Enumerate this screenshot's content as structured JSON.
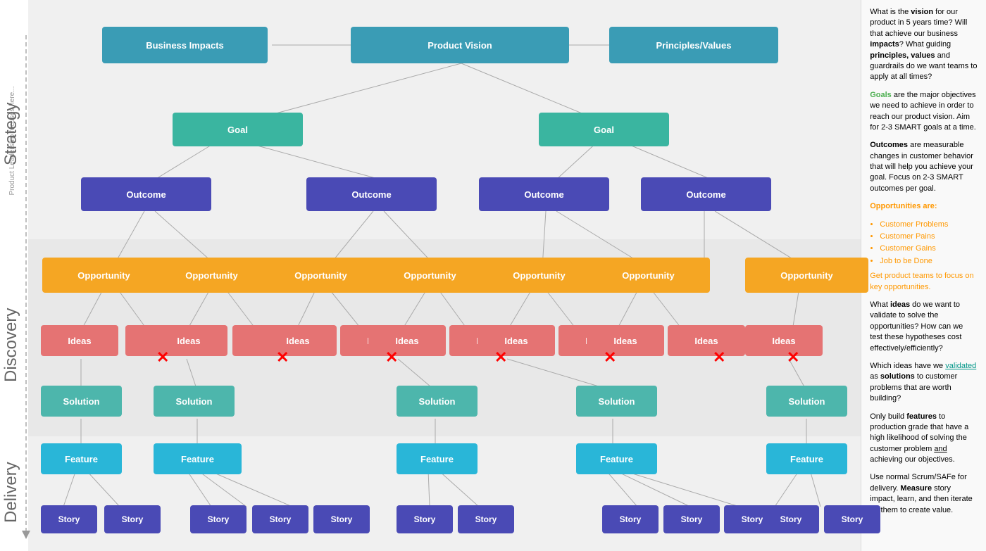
{
  "labels": {
    "strategy": "Strategy",
    "discovery": "Discovery",
    "delivery": "Delivery",
    "business_impacts": "Business Impacts",
    "product_vision": "Product Vision",
    "principles_values": "Principles/Values",
    "goal": "Goal",
    "outcome": "Outcome",
    "opportunity": "Opportunity",
    "ideas": "Ideas",
    "solution": "Solution",
    "feature": "Feature",
    "story": "Story"
  },
  "sidebar": {
    "vision_q": "What is the ",
    "vision_bold": "vision",
    "vision_q2": " for our product in 5 years time? Will that achieve our business ",
    "impacts_bold": "impacts",
    "impacts_q": "? What guiding ",
    "principles_bold": "principles, values",
    "principles_q": " and guardrails do we want teams to apply at all times?",
    "goals_label": "Goals",
    "goals_text": " are the major objectives we need to achieve in order to reach our product vision. Aim for 2-3 SMART goals at a time.",
    "outcomes_bold": "Outcomes",
    "outcomes_text": " are measurable changes in customer behavior that will help you achieve your goal. Focus on 2-3 SMART outcomes per goal.",
    "opportunities_bold": "Opportunities are:",
    "opp_items": [
      "Customer Problems",
      "Customer Pains",
      "Customer Gains",
      "Job to be Done"
    ],
    "opp_footer": "Get product teams to focus on key opportunities.",
    "ideas_q": "What ",
    "ideas_bold": "ideas",
    "ideas_q2": " do we want to validate to solve the opportunities? How can we test these hypotheses cost effectively/efficiently?",
    "solutions_q": "Which ideas have we ",
    "solutions_link": "validated",
    "solutions_q2": " as ",
    "solutions_bold": "solutions",
    "solutions_q3": " to customer problems that are worth building?",
    "features_q": "Only build ",
    "features_bold": "features",
    "features_q2": " to production grade that have a high likelihood of solving the customer problem ",
    "features_link": "and",
    "features_q3": " achieving our objectives.",
    "stories_q": "Use normal Scrum/SAFe for delivery. ",
    "stories_bold": "Measure",
    "stories_q2": " story impact, learn, and then iterate on them to create value."
  },
  "colors": {
    "teal_dark": "#3a9cb5",
    "teal_medium": "#3ab5a0",
    "blue_dark": "#4a4ab5",
    "orange": "#f5a623",
    "salmon": "#e57373",
    "teal_light": "#4db6ac",
    "sky_blue": "#29b6d8",
    "green_text": "#4CAF50",
    "orange_text": "#FF9800",
    "teal_text": "#009688"
  }
}
